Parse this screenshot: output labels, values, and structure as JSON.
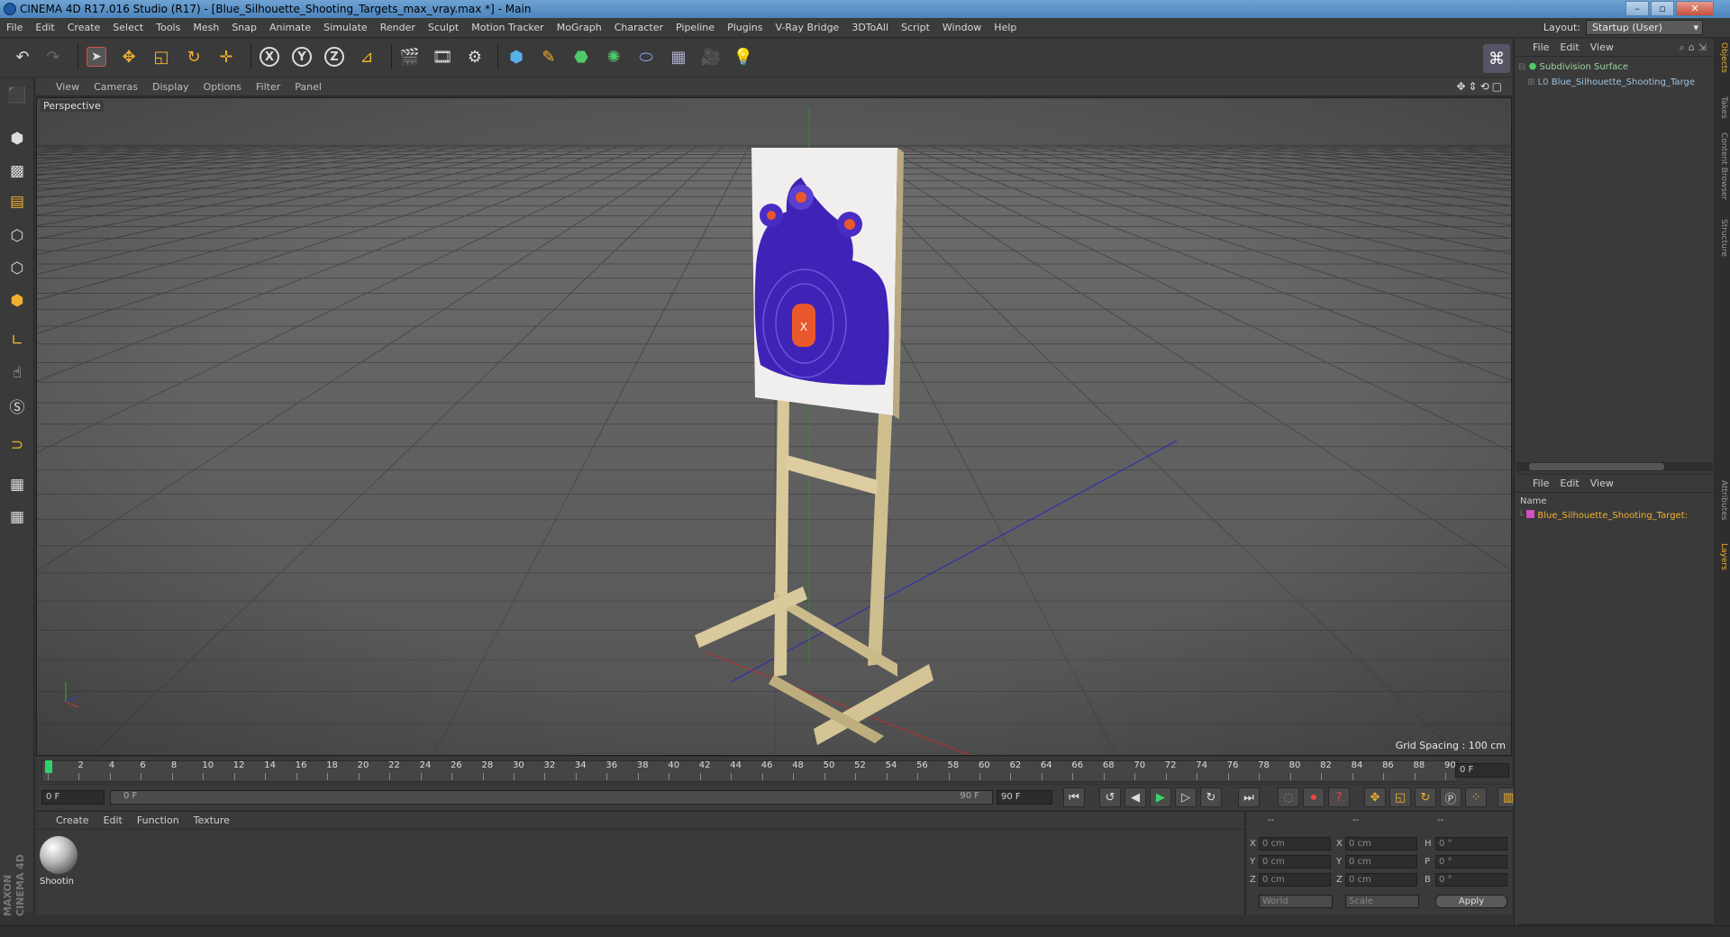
{
  "window": {
    "title": "CINEMA 4D R17.016 Studio (R17) - [Blue_Silhouette_Shooting_Targets_max_vray.max *] - Main"
  },
  "menubar": {
    "items": [
      "File",
      "Edit",
      "Create",
      "Select",
      "Tools",
      "Mesh",
      "Snap",
      "Animate",
      "Simulate",
      "Render",
      "Sculpt",
      "Motion Tracker",
      "MoGraph",
      "Character",
      "Pipeline",
      "Plugins",
      "V-Ray Bridge",
      "3DToAll",
      "Script",
      "Window",
      "Help"
    ],
    "layout_label": "Layout:",
    "layout_value": "Startup (User)"
  },
  "viewport": {
    "menu": [
      "View",
      "Cameras",
      "Display",
      "Options",
      "Filter",
      "Panel"
    ],
    "label": "Perspective",
    "grid_spacing": "Grid Spacing : 100 cm"
  },
  "timeline": {
    "ticks": [
      "0",
      "2",
      "4",
      "6",
      "8",
      "10",
      "12",
      "14",
      "16",
      "18",
      "20",
      "22",
      "24",
      "26",
      "28",
      "30",
      "32",
      "34",
      "36",
      "38",
      "40",
      "42",
      "44",
      "46",
      "48",
      "50",
      "52",
      "54",
      "56",
      "58",
      "60",
      "62",
      "64",
      "66",
      "68",
      "70",
      "72",
      "74",
      "76",
      "78",
      "80",
      "82",
      "84",
      "86",
      "88",
      "90"
    ],
    "current_frame": "0 F",
    "start_field": "0 F",
    "range_start": "0 F",
    "range_end": "90 F",
    "end_field": "90 F"
  },
  "material_manager": {
    "menu": [
      "Create",
      "Edit",
      "Function",
      "Texture"
    ],
    "material_name": "Shootin"
  },
  "coordinates": {
    "header": [
      "--",
      "--",
      "--"
    ],
    "rows": [
      {
        "a": "X",
        "av": "0 cm",
        "b": "X",
        "bv": "0 cm",
        "c": "H",
        "cv": "0 °"
      },
      {
        "a": "Y",
        "av": "0 cm",
        "b": "Y",
        "bv": "0 cm",
        "c": "P",
        "cv": "0 °"
      },
      {
        "a": "Z",
        "av": "0 cm",
        "b": "Z",
        "bv": "0 cm",
        "c": "B",
        "cv": "0 °"
      }
    ],
    "world": "World",
    "scale": "Scale",
    "apply": "Apply"
  },
  "object_manager": {
    "menu": [
      "File",
      "Edit",
      "View"
    ],
    "objects": [
      "Subdivision Surface",
      "Blue_Silhouette_Shooting_Targe"
    ]
  },
  "layer_manager": {
    "menu": [
      "File",
      "Edit",
      "View"
    ],
    "column": "Name",
    "layer": "Blue_Silhouette_Shooting_Target:"
  },
  "side_tabs": [
    "Objects",
    "Takes",
    "Content Browser",
    "Structure",
    "Attributes",
    "Layers"
  ],
  "brand": "MAXON CINEMA 4D",
  "colors": {
    "accent": "#f0b030",
    "layer": "#d44fc0",
    "target_blue": "#3f22b4",
    "target_orange": "#e8582a"
  }
}
